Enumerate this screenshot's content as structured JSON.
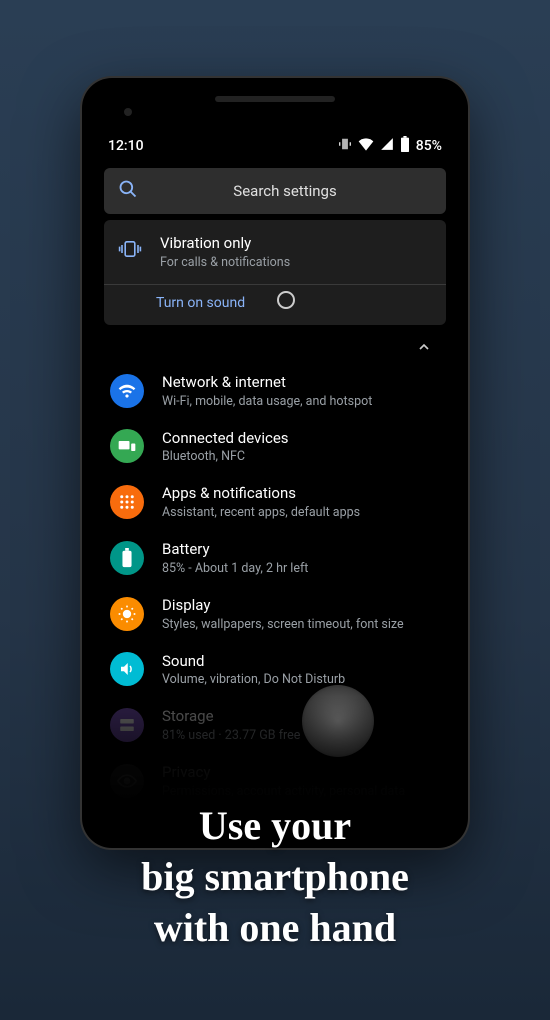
{
  "statusbar": {
    "time": "12:10",
    "battery": "85%"
  },
  "search": {
    "placeholder": "Search settings"
  },
  "card": {
    "title": "Vibration only",
    "subtitle": "For calls & notifications",
    "action": "Turn on sound"
  },
  "settings": [
    {
      "key": "network",
      "title": "Network & internet",
      "sub": "Wi-Fi, mobile, data usage, and hotspot",
      "color": "c-blue"
    },
    {
      "key": "devices",
      "title": "Connected devices",
      "sub": "Bluetooth, NFC",
      "color": "c-green"
    },
    {
      "key": "apps",
      "title": "Apps & notifications",
      "sub": "Assistant, recent apps, default apps",
      "color": "c-orange"
    },
    {
      "key": "battery",
      "title": "Battery",
      "sub": "85% - About 1 day, 2 hr left",
      "color": "c-teal"
    },
    {
      "key": "display",
      "title": "Display",
      "sub": "Styles, wallpapers, screen timeout, font size",
      "color": "c-amber"
    },
    {
      "key": "sound",
      "title": "Sound",
      "sub": "Volume, vibration, Do Not Disturb",
      "color": "c-cyan"
    },
    {
      "key": "storage",
      "title": "Storage",
      "sub": "81% used · 23.77 GB free",
      "color": "c-purple"
    },
    {
      "key": "privacy",
      "title": "Privacy",
      "sub": "Permissions, account activity, personal data",
      "color": "c-grey"
    }
  ],
  "caption": "Use your\nbig smartphone\nwith one hand"
}
